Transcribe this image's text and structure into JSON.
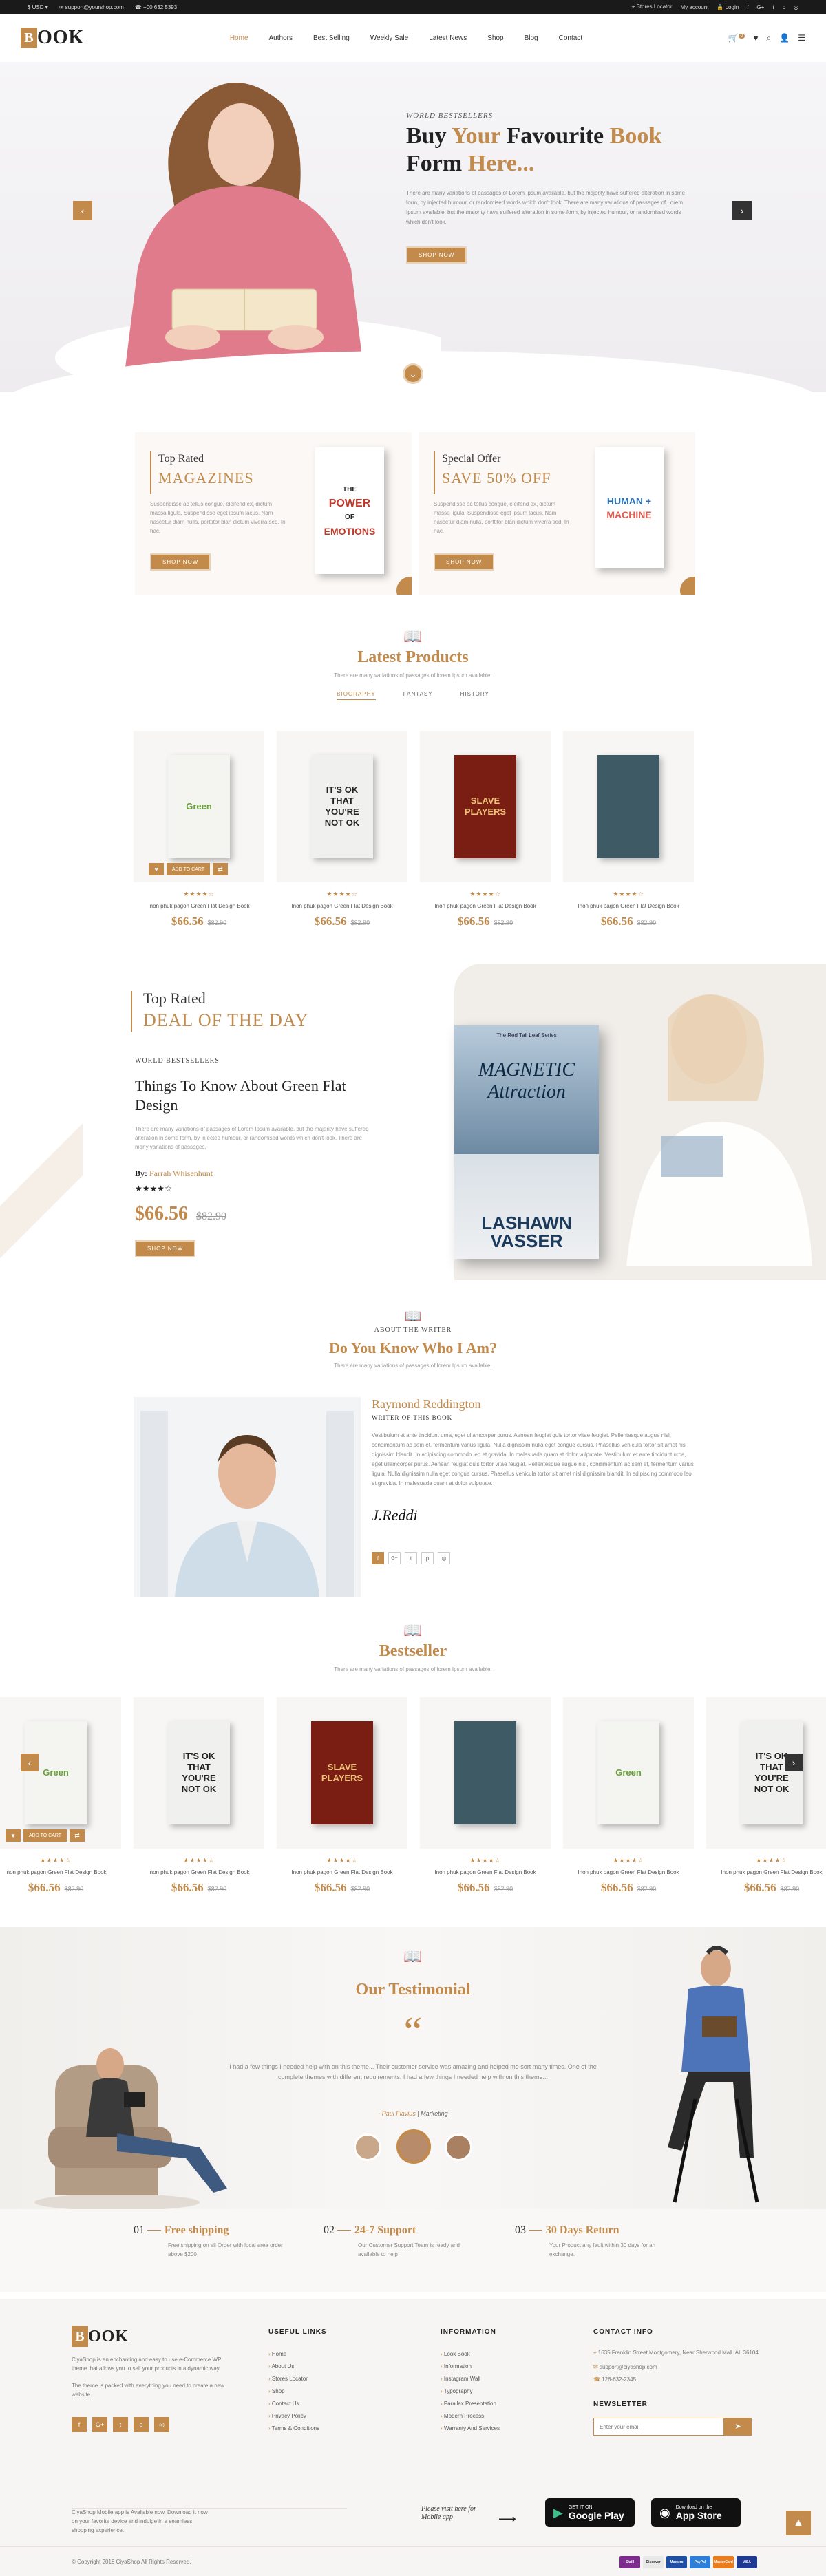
{
  "topbar": {
    "currency": "$ USD",
    "email": "support@yourshop.com",
    "phone": "+00 632 5393",
    "store_locator": "Stores Locator",
    "account": "My account",
    "login": "Login"
  },
  "header": {
    "logo_letter": "B",
    "logo_text": "OOK",
    "nav": [
      "Home",
      "Authors",
      "Best Selling",
      "Weekly Sale",
      "Latest News",
      "Shop",
      "Blog",
      "Contact"
    ],
    "cart_count": "0"
  },
  "hero": {
    "eyebrow": "WORLD BESTSELLERS",
    "title_a": "Buy ",
    "title_b": "Your",
    "title_c": " Favourite ",
    "title_d": "Book",
    "title_e": "Form ",
    "title_f": "Here...",
    "desc": "There are many variations of passages of Lorem Ipsum available, but the majority have suffered alteration in some form, by injected humour, or randomised words which don't look. There are many variations of passages of Lorem Ipsum available, but the majority have suffered alteration in some form, by injected humour, or randomised words which don't look.",
    "button": "SHOP NOW",
    "prev": "‹",
    "next": "›",
    "down": "⌄"
  },
  "promos": [
    {
      "small": "Top Rated",
      "big": "MAGAZINES",
      "desc": "Suspendisse ac tellus congue, eleifend ex, dictum massa ligula. Suspendisse eget ipsum lacus. Nam nascetur diam nulla, porttitor blan dictum viverra sed. In hac.",
      "button": "SHOP NOW",
      "book_l1": "THE",
      "book_l2": "POWER",
      "book_l3": "OF",
      "book_l4": "EMOTIONS"
    },
    {
      "small": "Special Offer",
      "big": "SAVE 50% OFF",
      "desc": "Suspendisse ac tellus congue, eleifend ex, dictum massa ligula. Suspendisse eget ipsum lacus. Nam nascetur diam nulla, porttitor blan dictum viverra sed. In hac.",
      "button": "SHOP NOW",
      "book_l1": "HUMAN +",
      "book_l2": "MACHINE"
    }
  ],
  "latest": {
    "title": "Latest Products",
    "subtitle": "There are many variations of passages of lorem Ipsum available.",
    "tabs": [
      "BIOGRAPHY",
      "FANTASY",
      "HISTORY"
    ],
    "add_to_cart": "ADD TO CART",
    "products": [
      {
        "title": "Inon phuk pagon Green Flat Design Book",
        "price": "$66.56",
        "old": "$82.90",
        "cover": "Green",
        "color": "#f4f4f0",
        "text": "#6aa23a"
      },
      {
        "title": "Inon phuk pagon Green Flat Design Book",
        "price": "$66.56",
        "old": "$82.90",
        "cover": "IT'S OK THAT YOU'RE NOT OK",
        "color": "#f0f0ee",
        "text": "#222"
      },
      {
        "title": "Inon phuk pagon Green Flat Design Book",
        "price": "$66.56",
        "old": "$82.90",
        "cover": "SLAVE PLAYERS",
        "color": "#7a1d12",
        "text": "#f1c27a"
      },
      {
        "title": "Inon phuk pagon Green Flat Design Book",
        "price": "$66.56",
        "old": "$82.90",
        "cover": "",
        "color": "#3e5a64",
        "text": "#fff"
      }
    ]
  },
  "deal": {
    "small": "Top Rated",
    "big": "DEAL OF THE DAY",
    "eyebrow": "WORLD BESTSELLERS",
    "title": "Things To Know About Green Flat Design",
    "desc": "There are many variations of passages of Lorem Ipsum available, but the majority have suffered alteration in some form, by injected humour, or randomised words which don't look. There are many variations of passages.",
    "by_label": "By:",
    "author": "Farrah Whisenhunt",
    "stars": "★★★★☆",
    "price": "$66.56",
    "old": "$82.90",
    "button": "SHOP NOW",
    "book_series": "The Red Tail Leaf Series",
    "book_title": "MAGNETIC Attraction",
    "book_author": "LASHAWN VASSER"
  },
  "writer": {
    "eyebrow": "ABOUT THE WRITER",
    "title": "Do You Know Who I Am?",
    "subtitle": "There are many variations of passages of lorem Ipsum available.",
    "name": "Raymond Reddington",
    "role": "WRITER OF THIS BOOK",
    "bio": "Vestibulum et ante tincidunt urna, eget ullamcorper purus. Aenean feugiat quis tortor vitae feugiat. Pellentesque augue nisl, condimentum ac sem et, fermentum varius ligula. Nulla dignissim nulla eget congue cursus. Phasellus vehicula tortor sit amet nisl dignissim blandit. In adipiscing commodo leo et gravida. In malesuada quam at dolor vulputate. Vestibulum et ante tincidunt urna, eget ullamcorper purus. Aenean feugiat quis tortor vitae feugiat. Pellentesque augue nisl, condimentum ac sem et, fermentum varius ligula. Nulla dignissim nulla eget congue cursus. Phasellus vehicula tortor sit amet nisl dignissim blandit. In adipiscing commodo leo et gravida. In malesuada quam at dolor vulputate.",
    "signature": "J.Reddi"
  },
  "bestseller": {
    "title": "Bestseller",
    "subtitle": "There are many variations of passages of lorem Ipsum available.",
    "products": [
      {
        "title": "Inon phuk pagon Green Flat Design Book",
        "price": "$66.56",
        "old": "$82.90",
        "cover": "Green",
        "color": "#f4f4f0",
        "text": "#6aa23a"
      },
      {
        "title": "Inon phuk pagon Green Flat Design Book",
        "price": "$66.56",
        "old": "$82.90",
        "cover": "IT'S OK THAT YOU'RE NOT OK",
        "color": "#f0f0ee",
        "text": "#222"
      },
      {
        "title": "Inon phuk pagon Green Flat Design Book",
        "price": "$66.56",
        "old": "$82.90",
        "cover": "SLAVE PLAYERS",
        "color": "#7a1d12",
        "text": "#f1c27a"
      },
      {
        "title": "Inon phuk pagon Green Flat Design Book",
        "price": "$66.56",
        "old": "$82.90",
        "cover": "",
        "color": "#3e5a64",
        "text": "#fff"
      },
      {
        "title": "Inon phuk pagon Green Flat Design Book",
        "price": "$66.56",
        "old": "$82.90",
        "cover": "Green",
        "color": "#f4f4f0",
        "text": "#6aa23a"
      },
      {
        "title": "Inon phuk pagon Green Flat Design Book",
        "price": "$66.56",
        "old": "$82.90",
        "cover": "IT'S OK THAT YOU'RE NOT OK",
        "color": "#f0f0ee",
        "text": "#222"
      }
    ]
  },
  "testimonial": {
    "title": "Our Testimonial",
    "quote": "I had a few things I needed help with on this theme... Their customer service was amazing and helped me sort many times. One of the complete themes with different requirements. I had a few things I needed help with on this theme...",
    "author": "- Paul Flavius",
    "role": "Marketing"
  },
  "features": [
    {
      "num": "01",
      "title": "Free shipping",
      "desc": "Free shipping on all Order with local area order above $200"
    },
    {
      "num": "02",
      "title": "24-7 Support",
      "desc": "Our Customer Support Team is ready and available to help"
    },
    {
      "num": "03",
      "title": "30 Days Return",
      "desc": "Your Product any fault within 30 days for an exchange."
    }
  ],
  "footer": {
    "about": "CiyaShop is an enchanting and easy to use e-Commerce WP theme that allows you to sell your products in a dynamic way.",
    "about2": "The theme is packed with everything you need to create a new website.",
    "useful_title": "USEFUL LINKS",
    "useful": [
      "Home",
      "About Us",
      "Stores Locator",
      "Shop",
      "Contact Us",
      "Privacy Policy",
      "Terms & Conditions"
    ],
    "info_title": "INFORMATION",
    "info": [
      "Look Book",
      "Information",
      "Instagram Wall",
      "Typography",
      "Parallax Presentation",
      "Modern Process",
      "Warranty And Services"
    ],
    "contact_title": "CONTACT INFO",
    "address": "1635 Franklin Street Montgomery, Near Sherwood Mall. AL 36104",
    "email": "support@ciyashop.com",
    "phone": "126-632-2345",
    "newsletter_title": "NEWSLETTER",
    "newsletter_placeholder": "Enter your email",
    "app_text": "CiyaShop Mobile app is Available now. Download it now on your favorite device and indulge in a seamless shopping experience.",
    "app_hand": "Please visit here for Mobile app",
    "google_small": "GET IT ON",
    "google_big": "Google Play",
    "apple_small": "Download on the",
    "apple_big": "App Store",
    "copyright": "© Copyright 2018 CiyaShop All Rights Reserved.",
    "payments": [
      "Skrill",
      "Discover",
      "Maestro",
      "PayPal",
      "MasterCard",
      "VISA"
    ]
  },
  "colors": {
    "accent": "#c28a4b",
    "dark": "#1a1a1a"
  }
}
